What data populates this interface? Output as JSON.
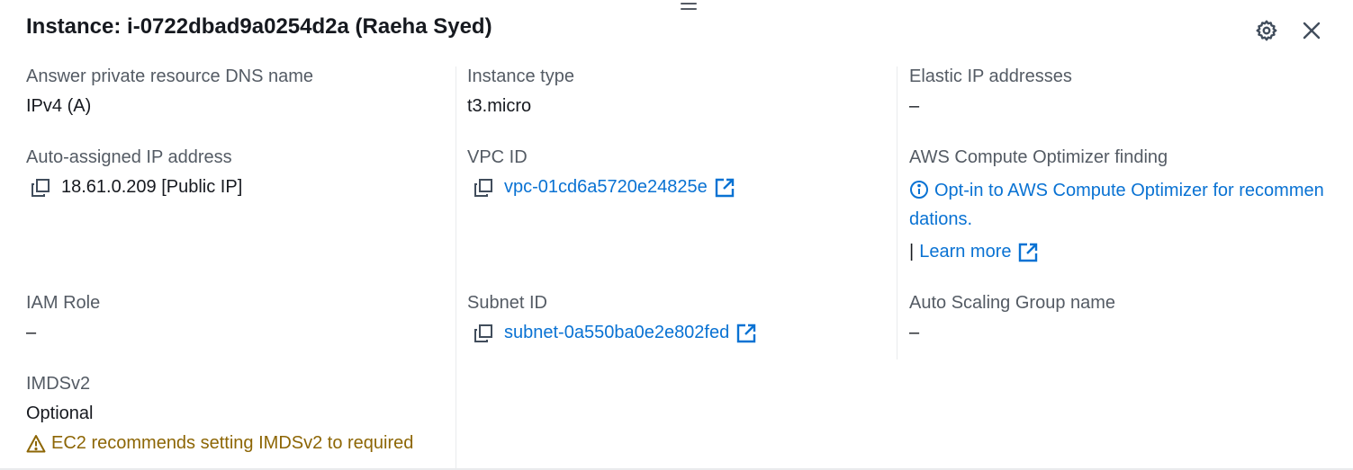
{
  "panel": {
    "title": "Instance: i-0722dbad9a0254d2a (Raeha Syed)",
    "icons": [
      "drag-handle-icon",
      "gear-icon",
      "close-icon"
    ]
  },
  "col1": {
    "dns_label": "Answer private resource DNS name",
    "dns_value": "IPv4 (A)",
    "ip_label": "Auto-assigned IP address",
    "ip_value": "18.61.0.209 [Public IP]",
    "iam_label": "IAM Role",
    "iam_value": "–",
    "imds_label": "IMDSv2",
    "imds_value": "Optional",
    "imds_warning": "EC2 recommends setting IMDSv2 to required"
  },
  "col2": {
    "type_label": "Instance type",
    "type_value": "t3.micro",
    "vpc_label": "VPC ID",
    "vpc_value": "vpc-01cd6a5720e24825e",
    "subnet_label": "Subnet ID",
    "subnet_value": "subnet-0a550ba0e2e802fed"
  },
  "col3": {
    "eip_label": "Elastic IP addresses",
    "eip_value": "–",
    "optimizer_label": "AWS Compute Optimizer finding",
    "optimizer_link": "Opt-in to AWS Compute Optimizer for recommendations.",
    "separator": "|",
    "learn_more": "Learn more",
    "asg_label": "Auto Scaling Group name",
    "asg_value": "–"
  },
  "colors": {
    "link": "#0972d3",
    "warning": "#8d6605",
    "label": "#545b64",
    "text": "#16191f"
  }
}
